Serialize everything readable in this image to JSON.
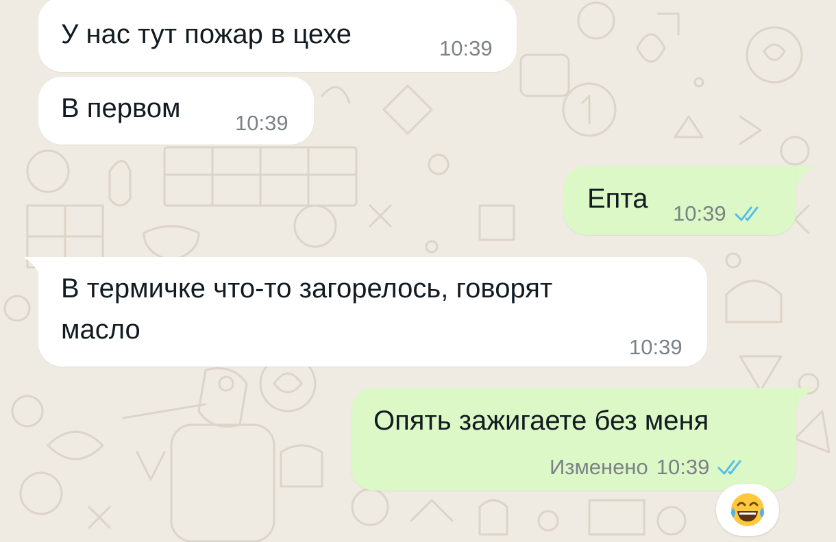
{
  "messages": [
    {
      "direction": "incoming",
      "text": "У нас тут пожар в цехе",
      "time": "10:39"
    },
    {
      "direction": "incoming",
      "text": "В первом",
      "time": "10:39"
    },
    {
      "direction": "outgoing",
      "text": "Епта",
      "time": "10:39",
      "read": true
    },
    {
      "direction": "incoming",
      "text_lines": [
        "В термичке что-то загорелось, говорят",
        "масло"
      ],
      "time": "10:39"
    },
    {
      "direction": "outgoing",
      "text": "Опять зажигаете без меня",
      "edited_label": "Изменено",
      "time": "10:39",
      "read": true
    }
  ],
  "reaction": {
    "emoji": "😂"
  },
  "colors": {
    "wallpaper": "#efeae2",
    "incoming_bubble": "#ffffff",
    "outgoing_bubble": "#dcf8c6",
    "timestamp": "#7b8186",
    "read_ticks": "#53bdeb"
  },
  "icons": {
    "read_receipt": "double-check-icon"
  }
}
